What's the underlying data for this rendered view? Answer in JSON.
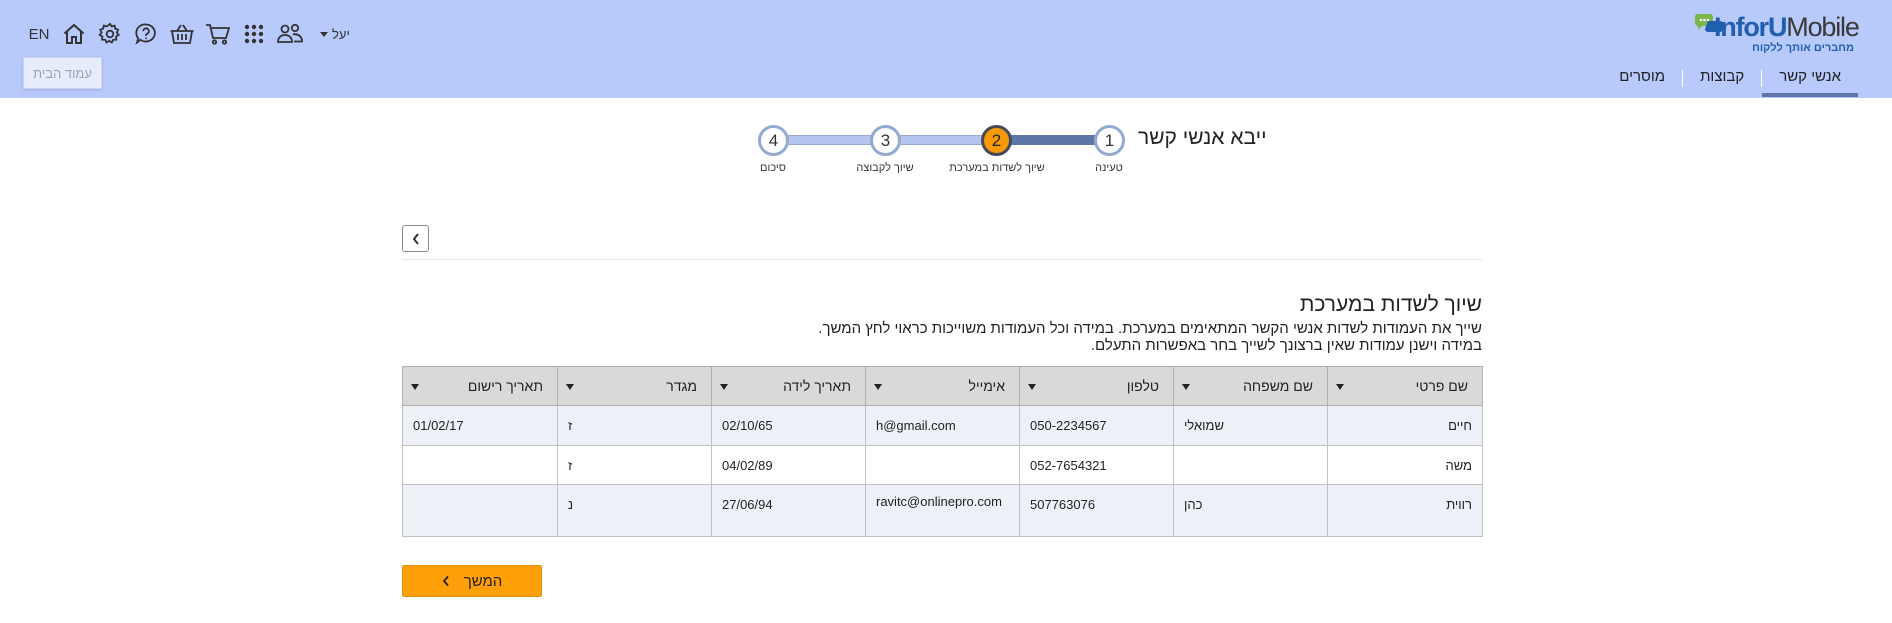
{
  "brand": {
    "logo_prefix": "InforU",
    "logo_suffix": "Mobile",
    "tagline": "מחברים אותך ללקוח",
    "accent_color": "#f79a06",
    "header_color": "#b8c9fc"
  },
  "nav": {
    "items": [
      {
        "label": "אנשי קשר",
        "active": true
      },
      {
        "label": "קבוצות",
        "active": false
      },
      {
        "label": "מוסרים",
        "active": false
      }
    ]
  },
  "toolbar": {
    "language": "EN",
    "user_name": "יעל",
    "icons": [
      "home-icon",
      "settings-icon",
      "help-icon",
      "basket-icon",
      "cart-icon",
      "apps-grid-icon",
      "users-icon"
    ],
    "tooltip": "עמוד הבית"
  },
  "wizard": {
    "title": "ייבא אנשי קשר",
    "current_step": 2,
    "steps": [
      {
        "number": "1",
        "label": "טעינה"
      },
      {
        "number": "2",
        "label": "שיוך לשדות במערכת"
      },
      {
        "number": "3",
        "label": "שיוך לקבוצה"
      },
      {
        "number": "4",
        "label": "סיכום"
      }
    ]
  },
  "section": {
    "title": "שיוך לשדות במערכת",
    "line1": "שייך את העמודות לשדות אנשי הקשר המתאימים במערכת. במידה וכל העמודות משוייכות כראוי לחץ המשך.",
    "line2": "במידה וישנן עמודות שאין ברצונך לשייך בחר באפשרות התעלם."
  },
  "table": {
    "headers": [
      "שם פרטי",
      "שם משפחה",
      "טלפון",
      "אימייל",
      "תאריך לידה",
      "מגדר",
      "תאריך רישום"
    ],
    "rows": [
      [
        "חיים",
        "שמואלי",
        "050-2234567",
        "h@gmail.com",
        "02/10/65",
        "ז",
        "01/02/17"
      ],
      [
        "משה",
        "",
        "052-7654321",
        "",
        "04/02/89",
        "ז",
        ""
      ],
      [
        "רווית",
        "כהן",
        "507763076",
        "ravitc@onlinepro.com",
        "27/06/94",
        "נ",
        ""
      ]
    ]
  },
  "actions": {
    "continue_label": "המשך"
  }
}
